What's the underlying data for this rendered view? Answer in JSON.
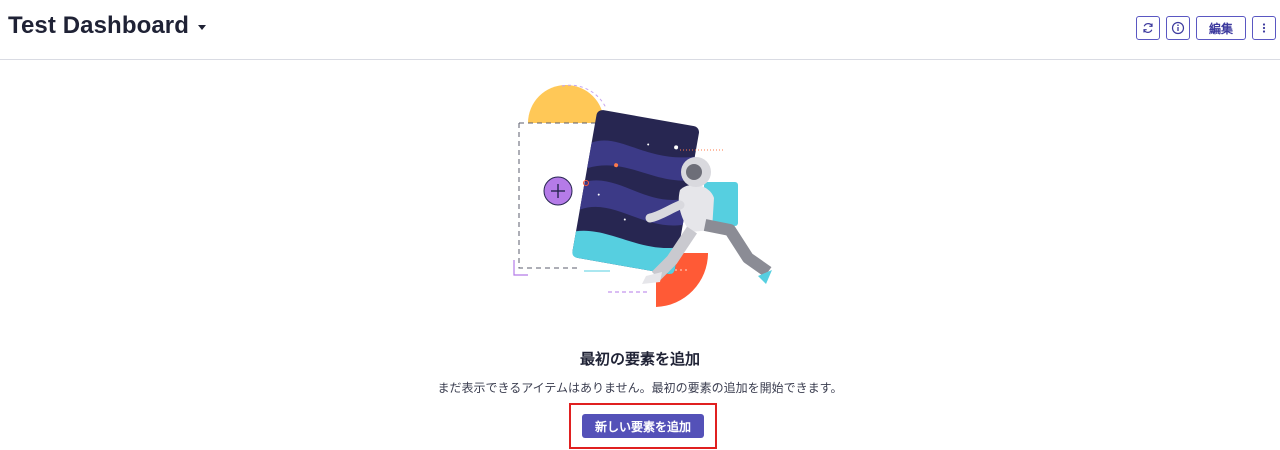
{
  "header": {
    "title": "Test Dashboard",
    "actions": {
      "refresh_icon": "refresh-icon",
      "info_icon": "info-icon",
      "edit_label": "編集",
      "more_icon": "more-vertical-icon"
    }
  },
  "empty_state": {
    "illustration": "astronaut-carrying-space-card",
    "title": "最初の要素を追加",
    "description": "まだ表示できるアイテムはありません。最初の要素の追加を開始できます。",
    "button_label": "新しい要素を追加"
  },
  "colors": {
    "primary": "#5451b8",
    "text": "#1f2235",
    "highlight": "#e02020",
    "illustration_navy": "#272651",
    "illustration_cyan": "#56cfe0",
    "illustration_yellow": "#ffc857",
    "illustration_orange": "#ff5a36",
    "illustration_purple": "#b57be8"
  }
}
